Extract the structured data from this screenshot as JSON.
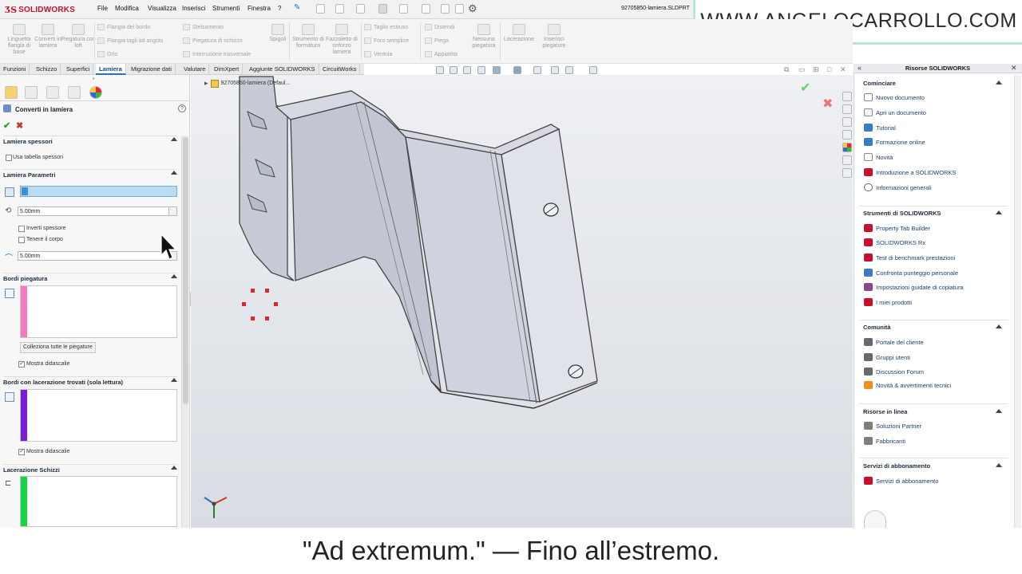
{
  "app": {
    "brand": "SOLIDWORKS",
    "document_title": "92705850-lamiera.SLDPRT"
  },
  "menu": {
    "items": [
      "File",
      "Modifica",
      "Visualizza",
      "Inserisci",
      "Strumenti",
      "Finestra",
      "?"
    ]
  },
  "banner": {
    "text": "WWW.ANGELOCARROLLO.COM"
  },
  "ribbon": {
    "big_buttons": [
      "Linguetta flangia di base",
      "Converti in lamiera",
      "Piegatura con loft",
      "Spigoli",
      "Strumento di formatura",
      "Fazzoletto di rinforzo lamiera",
      "Nessuna piegatura",
      "Lacerazione",
      "Inserisci piegature"
    ],
    "small_buttons": [
      "Flangia del bordo",
      "Flangia tagli ad angolo",
      "Orlo",
      "Stelsamento",
      "Piegatura di schizzo",
      "Interruzione trasversale",
      "Taglio estruso",
      "Foro semplice",
      "Ventola",
      "Distendi",
      "Piega",
      "Appiattita"
    ]
  },
  "tabs": [
    {
      "label": "Funzioni",
      "active": false
    },
    {
      "label": "Schizzo",
      "active": false
    },
    {
      "label": "Superfici",
      "active": false
    },
    {
      "label": "Lamiera",
      "active": true
    },
    {
      "label": "Migrazione dati",
      "active": false
    },
    {
      "label": "Valutare",
      "active": false
    },
    {
      "label": "DimXpert",
      "active": false
    },
    {
      "label": "Aggiunte SOLIDWORKS",
      "active": false
    },
    {
      "label": "CircuitWorks",
      "active": false
    }
  ],
  "property_manager": {
    "title": "Converti in lamiera",
    "sections": {
      "spessori": {
        "title": "Lamiera spessori",
        "use_table_label": "Usa tabella spessori",
        "use_table_checked": false
      },
      "parametri": {
        "title": "Lamiera Parametri",
        "thickness_value": "5.00mm",
        "invert_label": "Inverti spessore",
        "invert_checked": false,
        "keep_body_label": "Tenere il corpo",
        "keep_body_checked": false,
        "radius_value": "5.00mm"
      },
      "bordi_piegatura": {
        "title": "Bordi piegatura",
        "collect_button": "Colleziona tutte le piegature",
        "show_callouts_label": "Mostra didascalie",
        "show_callouts_checked": true,
        "color": "#f07bbf"
      },
      "bordi_lacerazione": {
        "title": "Bordi con lacerazione trovati (sola lettura)",
        "show_callouts_label": "Mostra didascalie",
        "show_callouts_checked": true,
        "color": "#7a1cd6"
      },
      "lacerazione_schizzi": {
        "title": "Lacerazione Schizzi",
        "color": "#19d24a"
      }
    }
  },
  "viewport": {
    "tree_label": "92705850-lamiera  (Defaul..."
  },
  "task_pane": {
    "title": "Risorse SOLIDWORKS",
    "sections": [
      {
        "title": "Cominciare",
        "items": [
          "Nuovo documento",
          "Apri un documento",
          "Tutorial",
          "Formazione online",
          "Novità",
          "Introduzione a SOLIDWORKS",
          "Informazioni generali"
        ]
      },
      {
        "title": "Strumenti di SOLIDWORKS",
        "items": [
          "Property Tab Builder",
          "SOLIDWORKS Rx",
          "Test di benchmark prestazioni",
          "Confronta punteggio personale",
          "Impostazioni guidate di copiatura",
          "I miei prodotti"
        ]
      },
      {
        "title": "Comunità",
        "items": [
          "Portale del cliente",
          "Gruppi utenti",
          "Discussion Forum",
          "Novità & avvertimenti tecnici"
        ]
      },
      {
        "title": "Risorse in linea",
        "items": [
          "Soluzioni Partner",
          "Fabbricanti"
        ]
      },
      {
        "title": "Servizi di abbonamento",
        "items": [
          "Servizi di abbonamento"
        ]
      }
    ]
  },
  "subtitle": {
    "text": "\"Ad extremum.\" — Fino all’estremo."
  },
  "colors": {
    "accent_blue": "#2d6fb0",
    "brand_red": "#c8102e"
  }
}
